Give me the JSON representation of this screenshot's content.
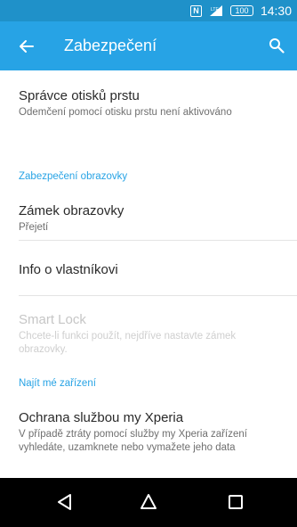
{
  "status_bar": {
    "nfc_icon": "nfc-icon",
    "signal_icon": "signal-icon",
    "battery_label": "100",
    "time": "14:30"
  },
  "app_bar": {
    "title": "Zabezpečení",
    "back_icon": "arrow-back-icon",
    "search_icon": "search-icon"
  },
  "items": [
    {
      "title": "Správce otisků prstu",
      "summary": "Odemčení pomocí otisku prstu není aktivováno"
    },
    {
      "section": "Zabezpečení obrazovky"
    },
    {
      "title": "Zámek obrazovky",
      "summary": "Přejetí"
    },
    {
      "title": "Info o vlastníkovi"
    },
    {
      "title": "Smart Lock",
      "summary": "Chcete-li funkci použít, nejdříve nastavte zámek obrazovky.",
      "disabled": true
    },
    {
      "section": "Najít mé zařízení"
    },
    {
      "title": "Ochrana službou my Xperia",
      "summary": "V případě ztráty pomocí služby my Xperia zařízení vyhledáte, uzamknete nebo vymažete jeho data"
    }
  ],
  "nav_bar": {
    "back": "triangle-back-icon",
    "home": "home-icon",
    "recents": "recents-icon"
  },
  "colors": {
    "status_bar": "#1f91c9",
    "app_bar": "#27a3e5",
    "accent": "#27a3e5",
    "nav_bar": "#000000"
  }
}
